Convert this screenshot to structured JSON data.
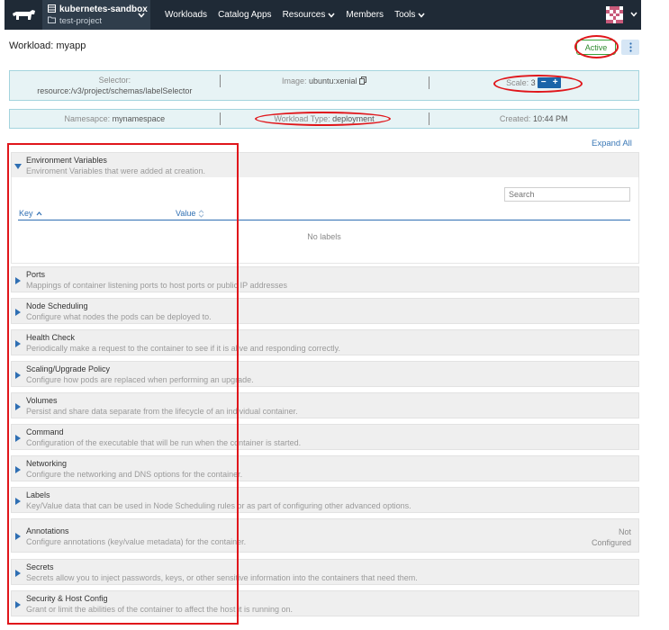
{
  "topnav": {
    "cluster_name": "kubernetes-sandbox",
    "project_name": "test-project",
    "items": [
      {
        "label": "Workloads",
        "dropdown": false
      },
      {
        "label": "Catalog Apps",
        "dropdown": false
      },
      {
        "label": "Resources",
        "dropdown": true
      },
      {
        "label": "Members",
        "dropdown": false
      },
      {
        "label": "Tools",
        "dropdown": true
      }
    ]
  },
  "header": {
    "title": "Workload: myapp",
    "status": "Active"
  },
  "info_row1": {
    "selector_label": "Selector:",
    "selector_value": "resource:/v3/project/schemas/labelSelector",
    "image_label": "Image:",
    "image_value": "ubuntu:xenial",
    "scale_label": "Scale:",
    "scale_value": "3"
  },
  "info_row2": {
    "namespace_label": "Namesapce:",
    "namespace_value": "mynamespace",
    "type_label": "Workload Type:",
    "type_value": "deployment",
    "created_label": "Created:",
    "created_value": "10:44 PM"
  },
  "expand_all": "Expand All",
  "env": {
    "name": "Environment Variables",
    "desc": "Enviroment Variables that were added at creation.",
    "search_placeholder": "Search",
    "col_key": "Key",
    "col_value": "Value",
    "empty": "No labels"
  },
  "sections": [
    {
      "name": "Ports",
      "desc": "Mappings of container listening ports to host ports or public IP addresses"
    },
    {
      "name": "Node Scheduling",
      "desc": "Configure what nodes the pods can be deployed to."
    },
    {
      "name": "Health Check",
      "desc": "Periodically make a request to the container to see if it is alive and responding correctly."
    },
    {
      "name": "Scaling/Upgrade Policy",
      "desc": "Configure how pods are replaced when performing an upgrade."
    },
    {
      "name": "Volumes",
      "desc": "Persist and share data separate from the lifecycle of an individual container."
    },
    {
      "name": "Command",
      "desc": "Configuration of the executable that will be run when the container is started."
    },
    {
      "name": "Networking",
      "desc": "Configure the networking and DNS options for the container."
    },
    {
      "name": "Labels",
      "desc": "Key/Value data that can be used in Node Scheduling rules or as part of configuring other advanced options."
    },
    {
      "name": "Annotations",
      "desc": "Configure annotations (key/value metadata) for the container.",
      "right1": "Not",
      "right2": "Configured"
    },
    {
      "name": "Secrets",
      "desc": "Secrets allow you to inject passwords, keys, or other sensitive information into the containers that need them."
    },
    {
      "name": "Security & Host Config",
      "desc": "Grant or limit the abilities of the container to affect the host it is running on."
    }
  ],
  "colors": {
    "nav_bg": "#1f2a36",
    "accent_blue": "#2f6fb3",
    "status_green": "#3aa13a",
    "annotation_red": "#e0161b"
  }
}
